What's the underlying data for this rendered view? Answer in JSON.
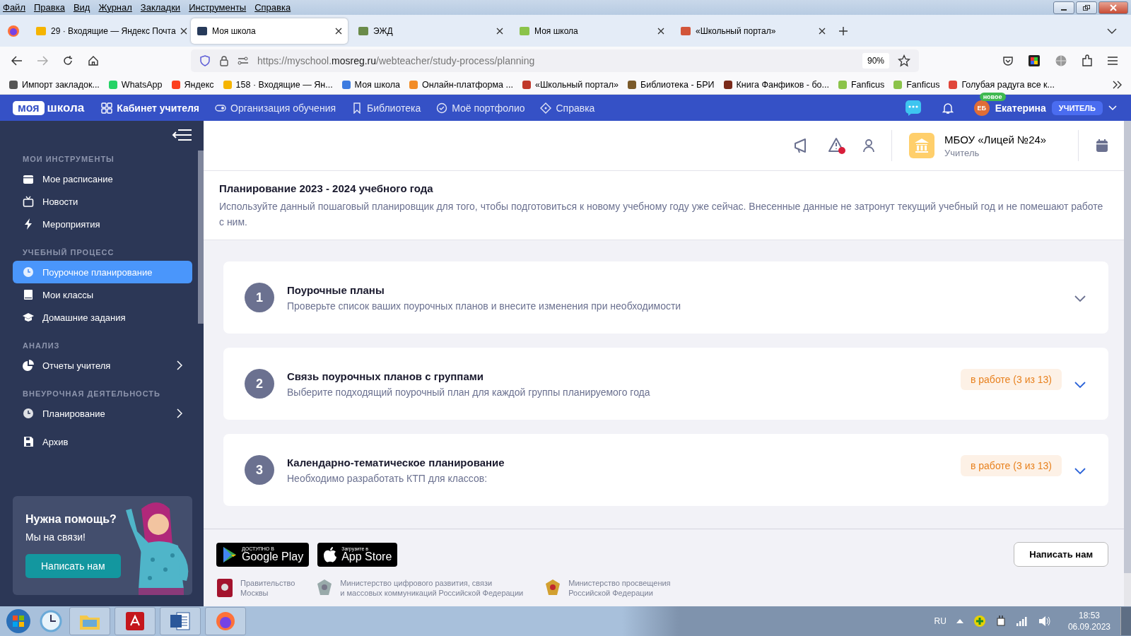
{
  "menu_bar": [
    "Файл",
    "Правка",
    "Вид",
    "Журнал",
    "Закладки",
    "Инструменты",
    "Справка"
  ],
  "browser_tabs": [
    {
      "title": "29 · Входящие — Яндекс Почта",
      "selected": false
    },
    {
      "title": "Моя школа",
      "selected": true
    },
    {
      "title": "ЭЖД",
      "selected": false
    },
    {
      "title": "Моя школа",
      "selected": false
    },
    {
      "title": "«Школьный портал»",
      "selected": false
    }
  ],
  "address_bar": {
    "url_prefix": "https://myschool.",
    "url_domain": "mosreg.ru",
    "url_path": "/webteacher/study-process/planning",
    "zoom": "90%"
  },
  "bookmarks": [
    "Импорт закладок...",
    "WhatsApp",
    "Яндекс",
    "158 · Входящие — Ян...",
    "Моя школа",
    "Онлайн-платформа ...",
    "«Школьный портал»",
    "Библиотека - БРИ",
    "Книга Фанфиков - бо...",
    "Fanficus",
    "Fanficus",
    "Голубая радуга все к..."
  ],
  "site_header": {
    "logo_badge": "моя",
    "logo_text": "школа",
    "nav": [
      {
        "label": "Кабинет учителя",
        "selected": true
      },
      {
        "label": "Организация обучения",
        "selected": false
      },
      {
        "label": "Библиотека",
        "selected": false
      },
      {
        "label": "Моё портфолио",
        "selected": false
      },
      {
        "label": "Справка",
        "selected": false
      }
    ],
    "user": {
      "badge": "новое",
      "initials": "ЕБ",
      "name": "Екатерина",
      "role": "УЧИТЕЛЬ"
    }
  },
  "sidebar": {
    "sections": [
      {
        "title": "МОИ ИНСТРУМЕНТЫ",
        "items": [
          {
            "label": "Мое расписание",
            "selected": false,
            "has_submenu": false
          },
          {
            "label": "Новости",
            "selected": false,
            "has_submenu": false
          },
          {
            "label": "Мероприятия",
            "selected": false,
            "has_submenu": false
          }
        ]
      },
      {
        "title": "УЧЕБНЫЙ ПРОЦЕСС",
        "items": [
          {
            "label": "Поурочное планирование",
            "selected": true,
            "has_submenu": false
          },
          {
            "label": "Мои классы",
            "selected": false,
            "has_submenu": false
          },
          {
            "label": "Домашние задания",
            "selected": false,
            "has_submenu": false
          }
        ]
      },
      {
        "title": "АНАЛИЗ",
        "items": [
          {
            "label": "Отчеты учителя",
            "selected": false,
            "has_submenu": true
          }
        ]
      },
      {
        "title": "ВНЕУРОЧНАЯ ДЕЯТЕЛЬНОСТЬ",
        "items": [
          {
            "label": "Планирование",
            "selected": false,
            "has_submenu": true
          }
        ]
      },
      {
        "items": [
          {
            "label": "Архив",
            "selected": false,
            "has_submenu": false
          }
        ]
      }
    ],
    "help": {
      "title": "Нужна помощь?",
      "subtitle": "Мы на связи!",
      "button": "Написать нам"
    }
  },
  "toolbar": {
    "alert_unread": true,
    "school": "МБОУ «Лицей №24»",
    "role": "Учитель"
  },
  "page": {
    "title": "Планирование 2023 - 2024 учебного года",
    "description": "Используйте данный пошаговый планировщик для того, чтобы подготовиться к новому учебному году уже сейчас. Внесенные данные не затронут текущий учебный год и не помешают работе с ним."
  },
  "steps": [
    {
      "number": "1",
      "title": "Поурочные планы",
      "subtitle": "Проверьте список ваших поурочных планов и внесите изменения при необходимости"
    },
    {
      "number": "2",
      "title": "Связь поурочных планов с группами",
      "subtitle": "Выберите подходящий поурочный план для каждой группы планируемого года",
      "status": "в работе (3 из 13)"
    },
    {
      "number": "3",
      "title": "Календарно-тематическое планирование",
      "subtitle": "Необходимо разработать КТП для классов:",
      "status": "в работе (3 из 13)"
    }
  ],
  "footer": {
    "stores": [
      {
        "caption": "ДОСТУПНО В",
        "name": "Google Play"
      },
      {
        "caption": "Загрузите в",
        "name": "App Store"
      }
    ],
    "partners": [
      {
        "line1": "Правительство",
        "line2": "Москвы"
      },
      {
        "line1": "Министерство цифрового развития, связи",
        "line2": "и массовых коммуникаций Российской Федерации"
      },
      {
        "line1": "Министерство просвещения",
        "line2": "Российской Федерации"
      }
    ],
    "contact_button": "Написать нам"
  },
  "taskbar": {
    "language": "RU",
    "time": "18:53",
    "date": "06.09.2023"
  }
}
